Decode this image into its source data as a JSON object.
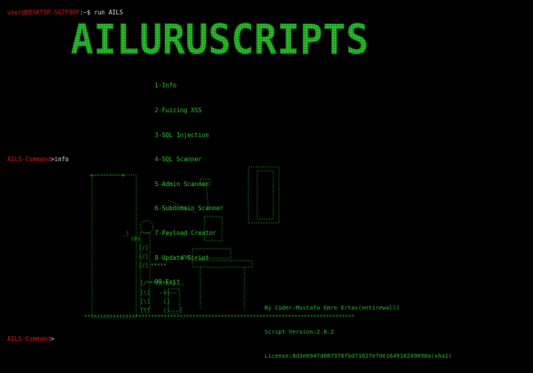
{
  "terminal": {
    "prompt_host": "user@DESKTOP-SGTF9OF",
    "prompt_suffix": ":~$ ",
    "command": "run AILS"
  },
  "banner": {
    "text": "AILURUSCRIPTS",
    "color": "#29e02a"
  },
  "menu": {
    "items": [
      "1-Info",
      "2-Fuzzing XSS",
      "3-SQL Injection",
      "4-SQL Scanner",
      "5-Admin Scanner",
      "6-Subdomain Scanner",
      "7-Payload Creator",
      "8-Update Script",
      "99-Exit"
    ]
  },
  "session": {
    "prompt_label": "AILS-Command",
    "first_input": "info",
    "second_input": ""
  },
  "credits": {
    "coder": "By Coder:Mustafa Emre Ertas(entirewall)",
    "version": "Script Version:2.0.2",
    "license": "License:8d3e694fd087376fbd71027e7de164916249090a(sha1)"
  },
  "colors": {
    "background": "#000000",
    "prompt_red": "#e8181c",
    "text_white": "#e8e8e8",
    "ascii_green": "#27b52a"
  }
}
